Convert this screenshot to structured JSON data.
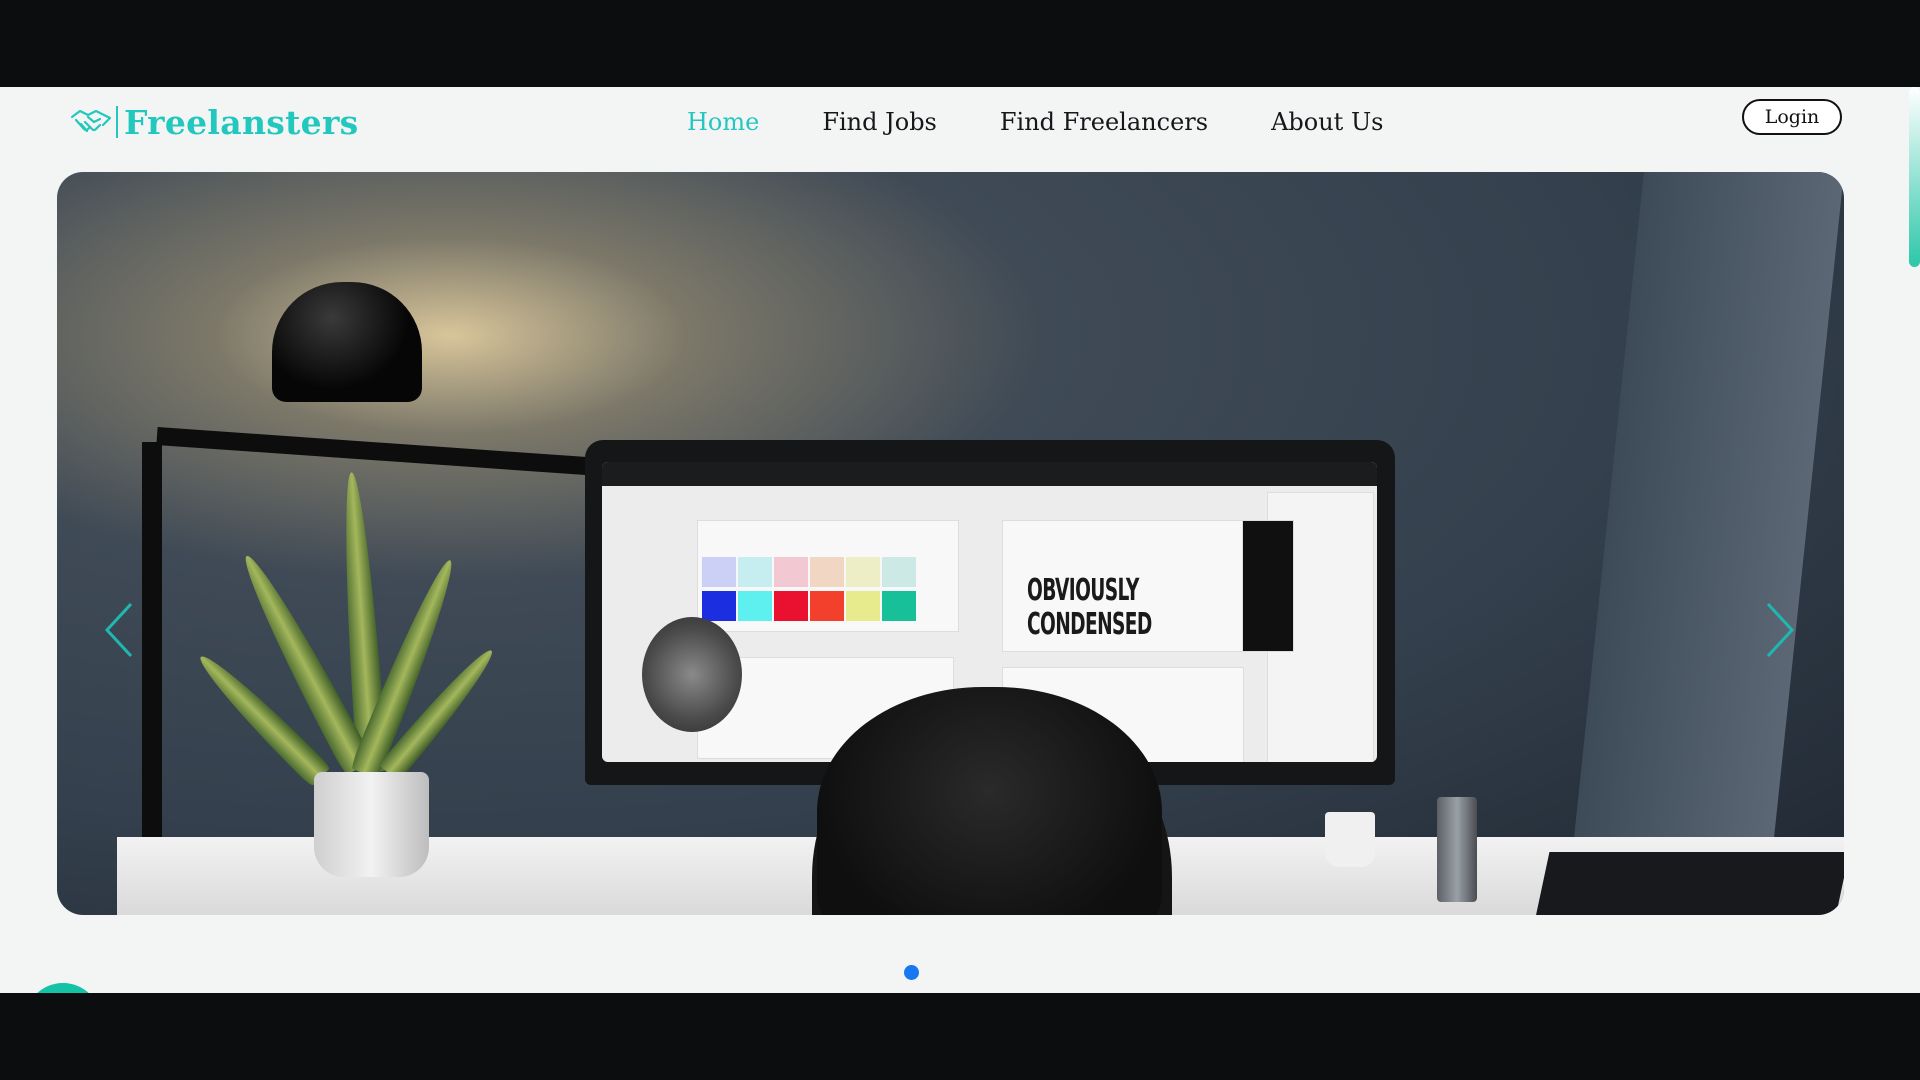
{
  "brand": {
    "name": "Freelansters",
    "color": "#22c8bd",
    "icon": "handshake-icon"
  },
  "nav": {
    "items": [
      {
        "label": "Home",
        "active": true
      },
      {
        "label": "Find Jobs",
        "active": false
      },
      {
        "label": "Find Freelancers",
        "active": false
      },
      {
        "label": "About Us",
        "active": false
      }
    ],
    "active_color": "#26c6c0"
  },
  "header": {
    "login_label": "Login"
  },
  "hero": {
    "image": "workspace-photo",
    "screen_headline": "OBVIOUSLY\nCONDENSED",
    "arrows": {
      "prev_icon": "chevron-left-icon",
      "next_icon": "chevron-right-icon",
      "color": "#1fb8b0"
    },
    "slides_count": 1,
    "active_slide": 1,
    "dot_color": "#1778f2"
  },
  "scroll_down_icon": "chevron-down-icon",
  "chat": {
    "icon": "chat-bubble-icon",
    "color": "#14c2a5"
  }
}
